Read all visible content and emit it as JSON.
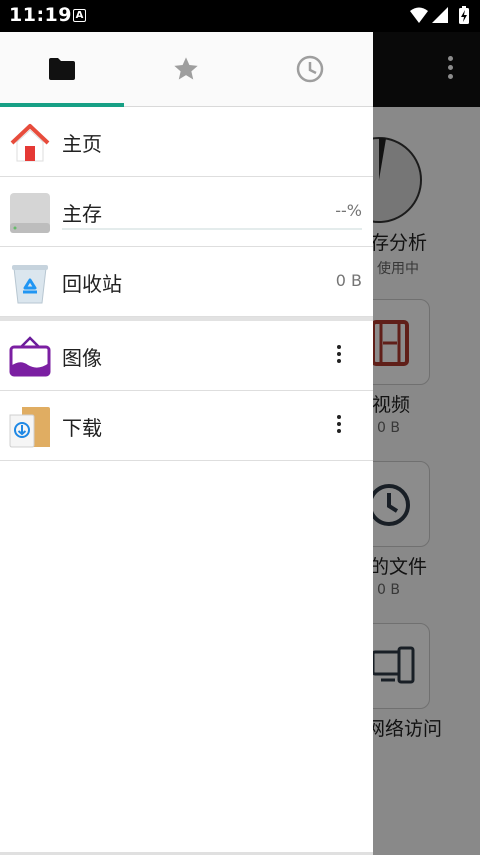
{
  "status_bar": {
    "time": "11:19",
    "notification_icon_letter": "A",
    "icons": [
      "wifi-icon",
      "signal-icon",
      "battery-charging-icon"
    ]
  },
  "background_app": {
    "storage_title": "存分析",
    "storage_sub": "使用中",
    "video_label": "视频",
    "video_size": "0 B",
    "recent_label": "的文件",
    "recent_size": "0 B",
    "network_label": "网络访问"
  },
  "drawer": {
    "tabs": [
      {
        "name": "folders",
        "icon": "folder-icon",
        "selected": true
      },
      {
        "name": "favorites",
        "icon": "star-icon",
        "selected": false
      },
      {
        "name": "recent",
        "icon": "clock-icon",
        "selected": false
      }
    ],
    "accent_color": "#17a085",
    "items": [
      {
        "label": "主页",
        "icon": "home-icon"
      },
      {
        "label": "主存",
        "icon": "storage-drive-icon",
        "value": "--%",
        "progress": 0
      },
      {
        "label": "回收站",
        "icon": "recycle-bin-icon",
        "value": "0 B"
      },
      {
        "label": "图像",
        "icon": "image-folder-icon"
      },
      {
        "label": "下载",
        "icon": "download-folder-icon"
      }
    ]
  }
}
